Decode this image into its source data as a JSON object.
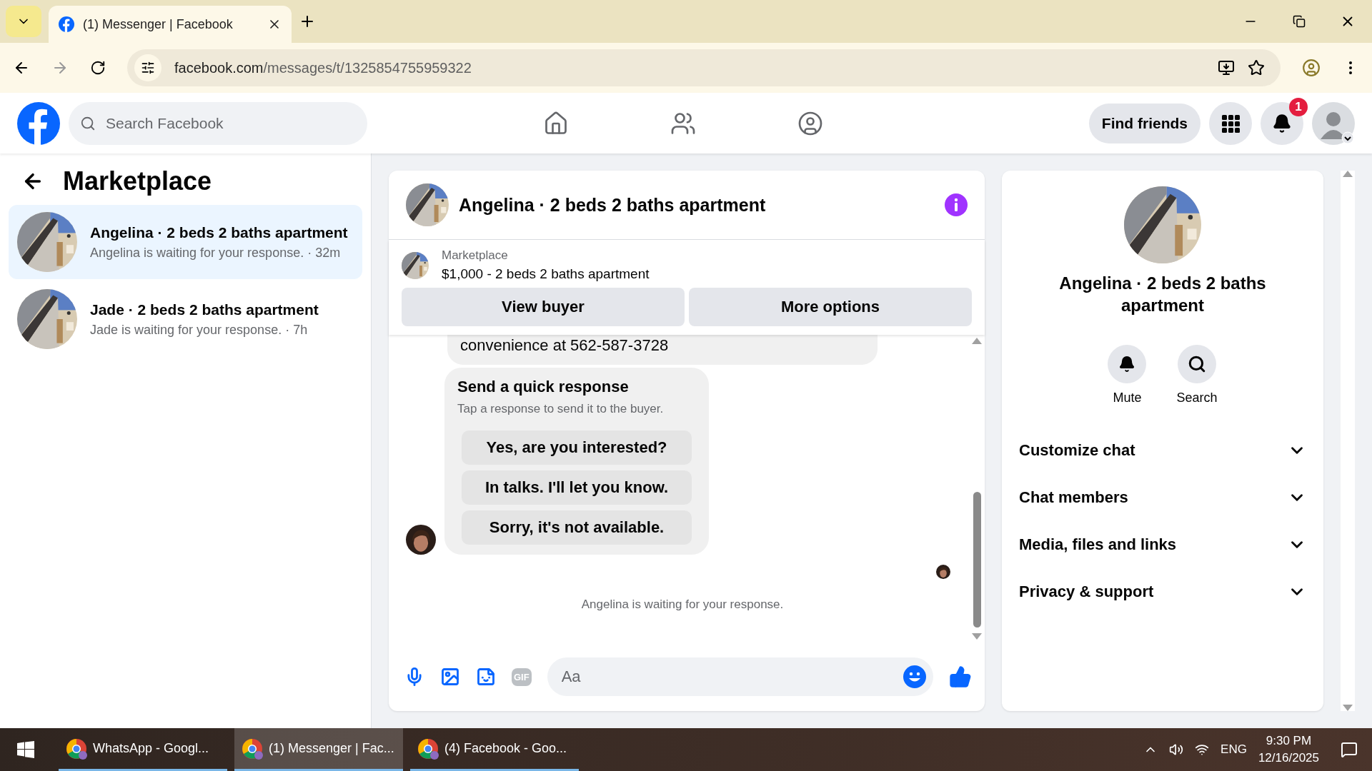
{
  "browser": {
    "tabs": [
      {
        "title": "(1) Messenger | Facebook",
        "selected": true
      }
    ],
    "url_host": "facebook.com",
    "url_path": "/messages/t/1325854755959322"
  },
  "header": {
    "search_placeholder": "Search Facebook",
    "find_friends": "Find friends",
    "notification_count": "1"
  },
  "sidebar": {
    "title": "Marketplace",
    "conversations": [
      {
        "name": "Angelina · 2 beds 2 baths apartment",
        "preview": "Angelina is waiting for your response. · 32m",
        "selected": true
      },
      {
        "name": "Jade · 2 beds 2 baths apartment",
        "preview": "Jade is waiting for your response. · 7h",
        "selected": false
      }
    ]
  },
  "chat": {
    "title": "Angelina · 2 beds 2 baths apartment",
    "listing": {
      "label": "Marketplace",
      "title": "$1,000 - 2 beds 2 baths apartment"
    },
    "buttons": [
      "View buyer",
      "More options"
    ],
    "message": "convenience at 562-587-3728",
    "quick_response": {
      "title": "Send a quick response",
      "subtitle": "Tap a response to send it to the buyer.",
      "options": [
        "Yes, are you interested?",
        "In talks. I'll let you know.",
        "Sorry, it's not available."
      ]
    },
    "status": "Angelina is waiting for your response.",
    "composer": {
      "gif_label": "GIF",
      "placeholder": "Aa"
    }
  },
  "details": {
    "name": "Angelina · 2 beds 2 baths apartment",
    "actions": [
      {
        "kind": "mute",
        "label": "Mute"
      },
      {
        "kind": "search",
        "label": "Search"
      }
    ],
    "sections": [
      {
        "label": "Customize chat",
        "expanded": false
      },
      {
        "label": "Chat members",
        "expanded": false
      },
      {
        "label": "Media, files and links",
        "expanded": false
      },
      {
        "label": "Privacy & support",
        "expanded": false
      }
    ]
  },
  "taskbar": {
    "apps": [
      {
        "label": "WhatsApp - Googl...",
        "selected": false
      },
      {
        "label": "(1) Messenger | Fac...",
        "selected": true
      },
      {
        "label": "(4) Facebook - Goo...",
        "selected": false
      }
    ],
    "language": "ENG",
    "time": "9:30 PM",
    "date": "12/16/2025"
  }
}
